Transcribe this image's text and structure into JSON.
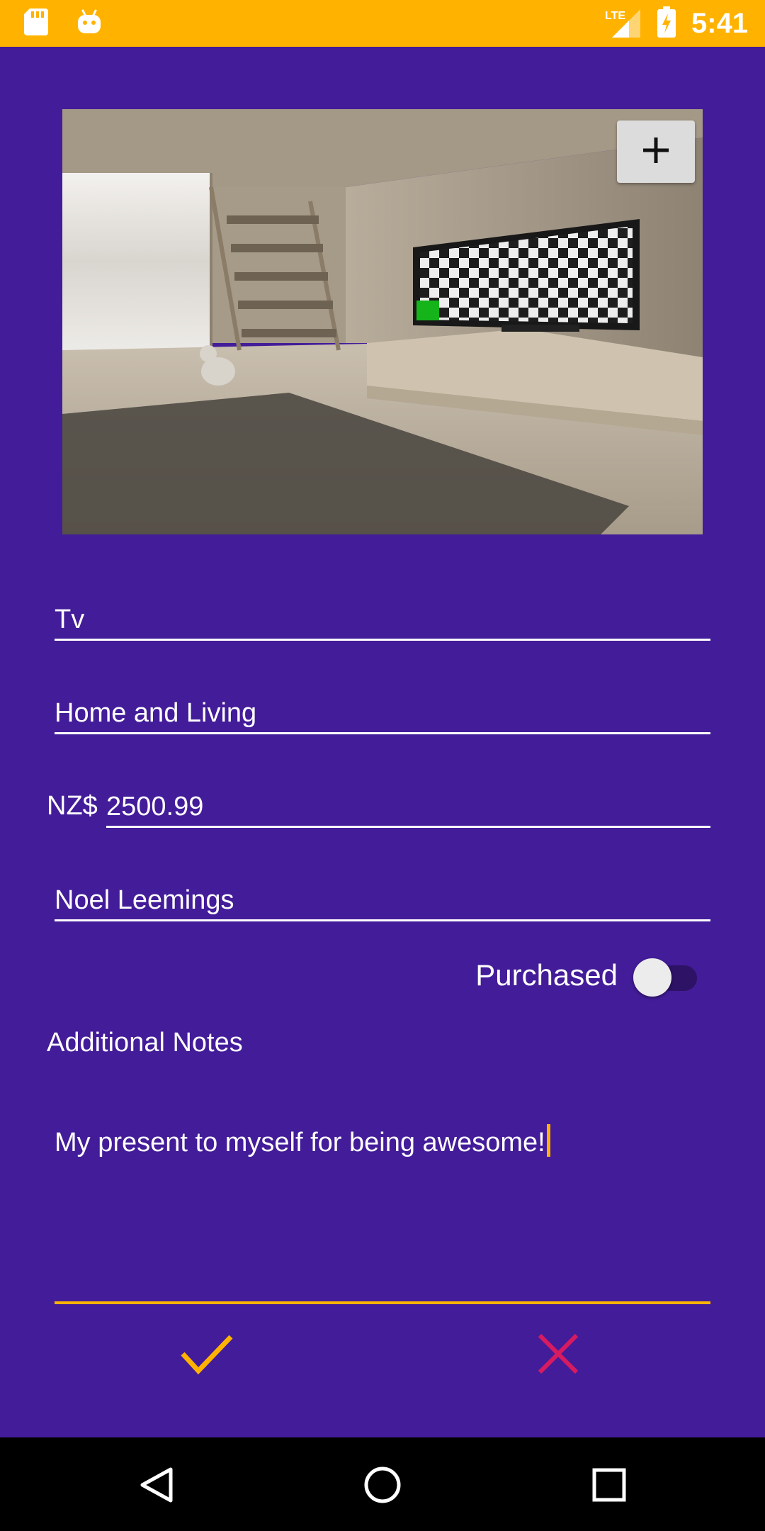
{
  "status_bar": {
    "time": "5:41",
    "network": "LTE",
    "background": "#FFB300",
    "icons": [
      "sd-card-icon",
      "android-icon",
      "lte-signal-icon",
      "battery-charging-icon"
    ]
  },
  "item": {
    "add_photo_symbol": "+",
    "name": "Tv",
    "category": "Home and Living",
    "currency": "NZ$",
    "price": "2500.99",
    "store": "Noel Leemings",
    "purchased_label": "Purchased",
    "purchased": false,
    "notes_heading": "Additional Notes",
    "notes": "My present to myself for being awesome!"
  },
  "actions": {
    "confirm_icon": "check-icon",
    "cancel_icon": "close-icon",
    "confirm_color": "#FFB300",
    "cancel_color": "#D81B60"
  },
  "nav": {
    "icons": [
      "back-icon",
      "home-icon",
      "recents-icon"
    ]
  },
  "colors": {
    "background": "#431C99",
    "accent": "#FFB300"
  }
}
